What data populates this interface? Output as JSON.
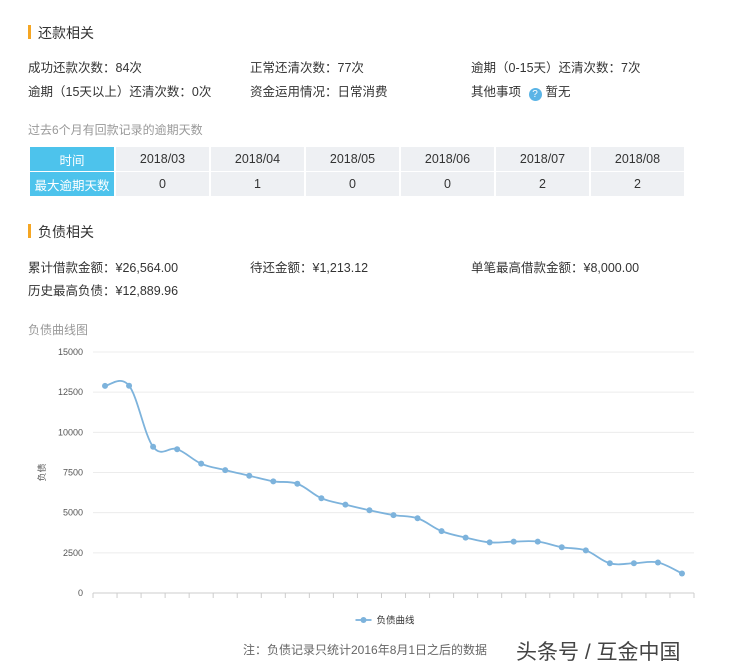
{
  "repay": {
    "title": "还款相关",
    "rows": [
      [
        {
          "label": "成功还款次数：",
          "value": "84次"
        },
        {
          "label": "正常还清次数：",
          "value": "77次"
        },
        {
          "label": "逾期（0-15天）还清次数：",
          "value": "7次"
        }
      ],
      [
        {
          "label": "逾期（15天以上）还清次数：",
          "value": "0次"
        },
        {
          "label": "资金运用情况：",
          "value": "日常消费"
        },
        {
          "label": "其他事项",
          "value": "暂无"
        }
      ]
    ],
    "info_icon": "question-icon"
  },
  "overdue": {
    "caption": "过去6个月有回款记录的逾期天数",
    "row_header_time": "时间",
    "row_header_days": "最大逾期天数",
    "months": [
      "2018/03",
      "2018/04",
      "2018/05",
      "2018/06",
      "2018/07",
      "2018/08"
    ],
    "days": [
      "0",
      "1",
      "0",
      "0",
      "2",
      "2"
    ]
  },
  "debt": {
    "title": "负债相关",
    "rows": [
      [
        {
          "label": "累计借款金额：",
          "value": "¥26,564.00"
        },
        {
          "label": "待还金额：",
          "value": "¥1,213.12"
        },
        {
          "label": "单笔最高借款金额：",
          "value": "¥8,000.00"
        }
      ],
      [
        {
          "label": "历史最高负债：",
          "value": "¥12,889.96"
        }
      ]
    ]
  },
  "chart_caption": "负债曲线图",
  "chart_data": {
    "type": "line",
    "ylabel": "负债",
    "ylim": [
      0,
      15000
    ],
    "yticks": [
      "0",
      "2500",
      "5000",
      "7500",
      "10000",
      "12500",
      "15000"
    ],
    "grid": true,
    "legend_position": "bottom",
    "series": [
      {
        "name": "负债曲线",
        "color": "#7db3dc",
        "values": [
          12889.96,
          12900,
          9100,
          8950,
          8050,
          7650,
          7300,
          6950,
          6800,
          5900,
          5500,
          5150,
          4850,
          4650,
          3850,
          3450,
          3150,
          3200,
          3200,
          2850,
          2650,
          1850,
          1850,
          1900,
          1213.12
        ]
      }
    ]
  },
  "footnote": "注：负债记录只统计2016年8月1日之后的数据",
  "colors": {
    "accent": "#f5a623",
    "table_header": "#4dc3ec",
    "table_cell": "#eef0f3",
    "line": "#7db3dc"
  },
  "watermark": "头条号 / 互金中国"
}
